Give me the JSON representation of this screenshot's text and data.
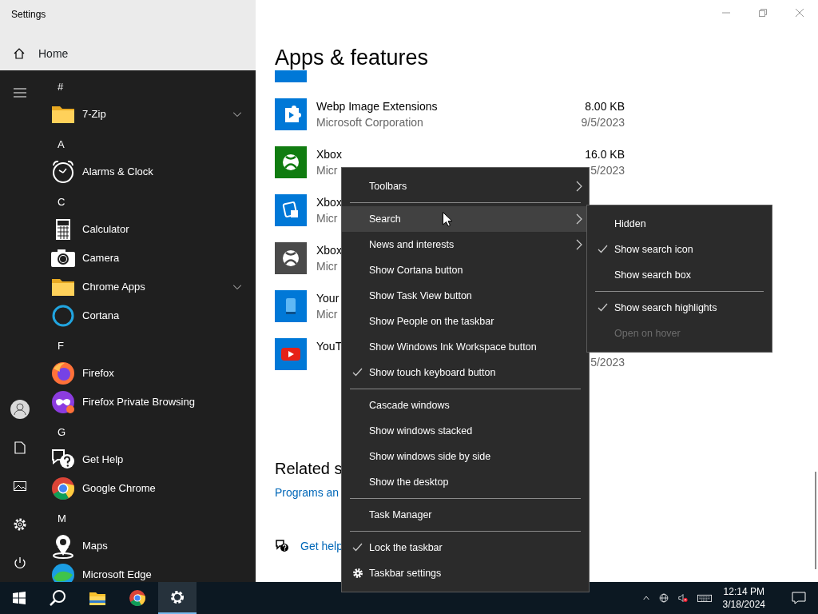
{
  "settings_window": {
    "title": "Settings",
    "home": "Home",
    "heading": "Apps & features",
    "apps": [
      {
        "kind": "partial"
      },
      {
        "kind": "app",
        "name": "Webp Image Extensions",
        "publisher": "Microsoft Corporation",
        "size": "8.00 KB",
        "date": "9/5/2023"
      },
      {
        "kind": "app",
        "name": "Xbox",
        "publisher": "Micr",
        "size": "16.0 KB",
        "date": "5/2023"
      },
      {
        "kind": "app",
        "name": "Xbox",
        "publisher": "Micr"
      },
      {
        "kind": "app",
        "name": "Xbox",
        "publisher": "Micr"
      },
      {
        "kind": "app",
        "name": "Your",
        "publisher": "Micr"
      },
      {
        "kind": "app",
        "name": "YouT",
        "date": "5/2023"
      }
    ],
    "related_heading": "Related s",
    "related_link": "Programs an",
    "help_link": "Get help"
  },
  "start_menu": {
    "items": [
      {
        "kind": "header",
        "label": "#"
      },
      {
        "kind": "folder",
        "label": "7-Zip",
        "expanded": false
      },
      {
        "kind": "header",
        "label": "A"
      },
      {
        "kind": "app",
        "label": "Alarms & Clock"
      },
      {
        "kind": "header",
        "label": "C"
      },
      {
        "kind": "app",
        "label": "Calculator"
      },
      {
        "kind": "app",
        "label": "Camera"
      },
      {
        "kind": "folder",
        "label": "Chrome Apps",
        "expanded": false
      },
      {
        "kind": "app",
        "label": "Cortana"
      },
      {
        "kind": "header",
        "label": "F"
      },
      {
        "kind": "app",
        "label": "Firefox"
      },
      {
        "kind": "app",
        "label": "Firefox Private Browsing"
      },
      {
        "kind": "header",
        "label": "G"
      },
      {
        "kind": "app",
        "label": "Get Help"
      },
      {
        "kind": "app",
        "label": "Google Chrome"
      },
      {
        "kind": "header",
        "label": "M"
      },
      {
        "kind": "app",
        "label": "Maps"
      },
      {
        "kind": "app",
        "label": "Microsoft Edge"
      }
    ]
  },
  "context_menu": {
    "groups": [
      {
        "items": [
          {
            "kind": "option",
            "label": "Toolbars",
            "checked": false,
            "submenu": true,
            "highlighted": false
          }
        ]
      },
      {
        "items": [
          {
            "kind": "option",
            "label": "Search",
            "checked": false,
            "submenu": true,
            "highlighted": true
          },
          {
            "kind": "option",
            "label": "News and interests",
            "checked": false,
            "submenu": true,
            "highlighted": false
          },
          {
            "kind": "option",
            "label": "Show Cortana button",
            "checked": false,
            "submenu": false,
            "highlighted": false
          },
          {
            "kind": "option",
            "label": "Show Task View button",
            "checked": false,
            "submenu": false,
            "highlighted": false
          },
          {
            "kind": "option",
            "label": "Show People on the taskbar",
            "checked": false,
            "submenu": false,
            "highlighted": false
          },
          {
            "kind": "option",
            "label": "Show Windows Ink Workspace button",
            "checked": false,
            "submenu": false,
            "highlighted": false
          },
          {
            "kind": "option",
            "label": "Show touch keyboard button",
            "checked": true,
            "submenu": false,
            "highlighted": false
          }
        ]
      },
      {
        "items": [
          {
            "kind": "option",
            "label": "Cascade windows",
            "checked": false,
            "submenu": false,
            "highlighted": false
          },
          {
            "kind": "option",
            "label": "Show windows stacked",
            "checked": false,
            "submenu": false,
            "highlighted": false
          },
          {
            "kind": "option",
            "label": "Show windows side by side",
            "checked": false,
            "submenu": false,
            "highlighted": false
          },
          {
            "kind": "option",
            "label": "Show the desktop",
            "checked": false,
            "submenu": false,
            "highlighted": false
          }
        ]
      },
      {
        "items": [
          {
            "kind": "option",
            "label": "Task Manager",
            "checked": false,
            "submenu": false,
            "highlighted": false
          }
        ]
      },
      {
        "items": [
          {
            "kind": "option",
            "label": "Lock the taskbar",
            "checked": true,
            "submenu": false,
            "highlighted": false
          },
          {
            "kind": "settings",
            "label": "Taskbar settings",
            "checked": false,
            "submenu": false,
            "highlighted": false
          }
        ]
      }
    ]
  },
  "search_submenu": {
    "groups": [
      {
        "items": [
          {
            "label": "Hidden",
            "checked": false,
            "disabled": false
          },
          {
            "label": "Show search icon",
            "checked": true,
            "disabled": false
          },
          {
            "label": "Show search box",
            "checked": false,
            "disabled": false
          }
        ]
      },
      {
        "items": [
          {
            "label": "Show search highlights",
            "checked": true,
            "disabled": false
          },
          {
            "label": "Open on hover",
            "checked": false,
            "disabled": true
          }
        ]
      }
    ]
  },
  "taskbar": {
    "apps": [
      {
        "selected": false
      },
      {
        "selected": false
      },
      {
        "selected": true
      }
    ],
    "time": "12:14 PM",
    "date": "3/18/2024"
  }
}
